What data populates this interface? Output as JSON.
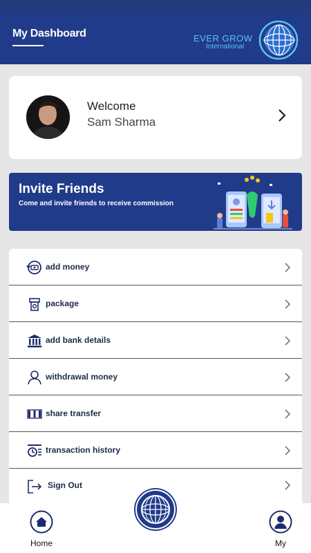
{
  "header": {
    "title": "My Dashboard",
    "logo_brand": "EVER GROW",
    "logo_sub": "International"
  },
  "profile": {
    "greeting": "Welcome",
    "name": "Sam Sharma"
  },
  "invite": {
    "title": "Invite Friends",
    "subtitle": "Come and invite friends to receive commission"
  },
  "menu": {
    "items": [
      {
        "label": "add money",
        "icon": "money-cycle-icon"
      },
      {
        "label": "package",
        "icon": "package-icon"
      },
      {
        "label": "add bank details",
        "icon": "bank-icon"
      },
      {
        "label": "withdrawal money",
        "icon": "user-icon"
      },
      {
        "label": "share transfer",
        "icon": "share-transfer-icon"
      },
      {
        "label": "transaction history",
        "icon": "transaction-history-icon"
      },
      {
        "label": "Sign Out",
        "icon": "sign-out-icon"
      }
    ]
  },
  "nav": {
    "home_label": "Home",
    "my_label": "My"
  },
  "colors": {
    "primary": "#213b8b",
    "accent": "#58c4ef",
    "background": "#e6e6e6"
  }
}
